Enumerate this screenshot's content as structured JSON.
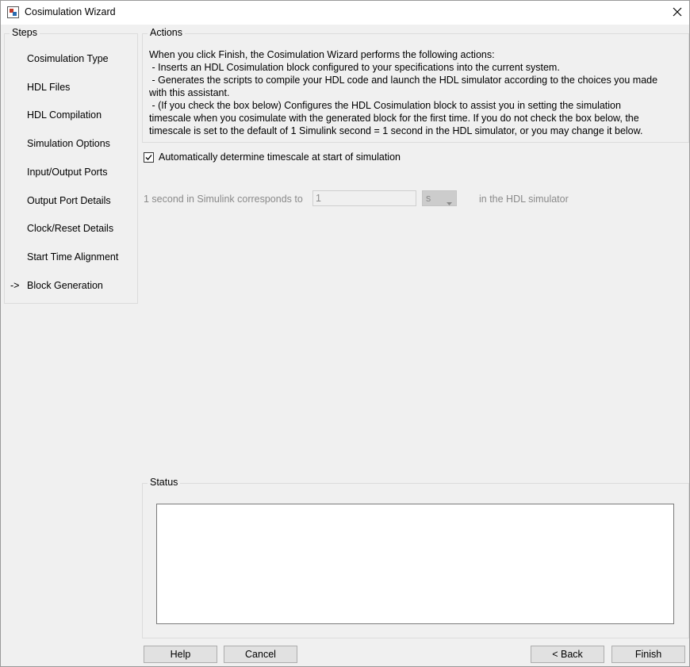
{
  "window": {
    "title": "Cosimulation Wizard"
  },
  "steps": {
    "legend": "Steps",
    "current_marker": "->",
    "items": [
      {
        "label": "Cosimulation Type"
      },
      {
        "label": "HDL Files"
      },
      {
        "label": "HDL Compilation"
      },
      {
        "label": "Simulation Options"
      },
      {
        "label": "Input/Output Ports"
      },
      {
        "label": "Output Port Details"
      },
      {
        "label": "Clock/Reset Details"
      },
      {
        "label": "Start Time Alignment"
      },
      {
        "label": "Block Generation"
      }
    ]
  },
  "actions": {
    "legend": "Actions",
    "lines": [
      "When you click Finish, the Cosimulation Wizard performs the following actions:",
      " - Inserts an HDL Cosimulation block configured to your specifications into the current system.",
      " - Generates the scripts to compile your HDL code and launch the HDL simulator according to the choices you made",
      "with this assistant.",
      " - (If you check the box below) Configures the HDL Cosimulation block to assist you in setting the simulation",
      "timescale when you cosimulate with the generated block for the first time. If you do not check the box below, the",
      "timescale is set to the default of 1 Simulink second = 1 second in the HDL simulator, or you may change it below."
    ]
  },
  "timescale": {
    "auto_label": "Automatically determine timescale at start of simulation",
    "auto_checked": true,
    "label": "1 second in Simulink corresponds to",
    "value": "1",
    "unit": "s",
    "suffix": "in the HDL simulator"
  },
  "status": {
    "legend": "Status",
    "text": ""
  },
  "buttons": {
    "help": "Help",
    "cancel": "Cancel",
    "back": "< Back",
    "finish": "Finish"
  }
}
